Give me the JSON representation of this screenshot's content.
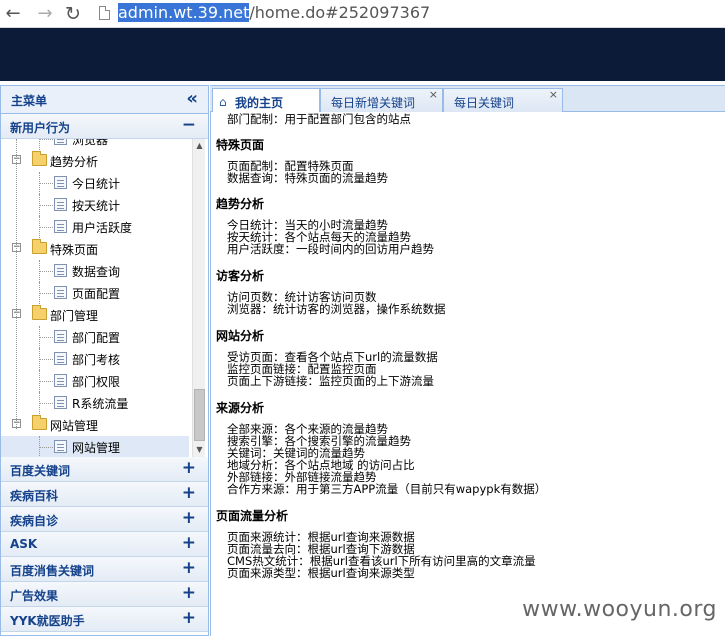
{
  "browser": {
    "url_selected": "admin.wt.39.net",
    "url_rest": "/home.do#252097367"
  },
  "sidebar": {
    "title": "主菜单",
    "section": "新用户行为",
    "section_toggle": "−",
    "tree": [
      {
        "label": "浏览器",
        "kind": "leaf"
      },
      {
        "label": "趋势分析",
        "kind": "folder",
        "toggle": "−"
      },
      {
        "label": "今日统计",
        "kind": "leaf"
      },
      {
        "label": "按天统计",
        "kind": "leaf"
      },
      {
        "label": "用户活跃度",
        "kind": "leaf"
      },
      {
        "label": "特殊页面",
        "kind": "folder",
        "toggle": "−"
      },
      {
        "label": "数据查询",
        "kind": "leaf"
      },
      {
        "label": "页面配置",
        "kind": "leaf"
      },
      {
        "label": "部门管理",
        "kind": "folder",
        "toggle": "−"
      },
      {
        "label": "部门配置",
        "kind": "leaf"
      },
      {
        "label": "部门考核",
        "kind": "leaf"
      },
      {
        "label": "部门权限",
        "kind": "leaf"
      },
      {
        "label": "R系统流量",
        "kind": "leaf"
      },
      {
        "label": "网站管理",
        "kind": "folder",
        "toggle": "−"
      },
      {
        "label": "网站管理",
        "kind": "leaf",
        "selected": true
      }
    ],
    "accordions": [
      {
        "label": "百度关键词",
        "toggle": "+"
      },
      {
        "label": "疾病百科",
        "toggle": "+"
      },
      {
        "label": "疾病自诊",
        "toggle": "+"
      },
      {
        "label": "ASK",
        "toggle": "+"
      },
      {
        "label": "百度消售关键词",
        "toggle": "+"
      },
      {
        "label": "广告效果",
        "toggle": "+"
      },
      {
        "label": "YYK就医助手",
        "toggle": "+"
      }
    ]
  },
  "tabs": [
    {
      "label": "我的主页",
      "active": true
    },
    {
      "label": "每日新增关键词",
      "close": "×"
    },
    {
      "label": "每日关键词",
      "close": "×"
    }
  ],
  "content": {
    "top_line": "部门配制：用于配置部门包含的站点",
    "sections": [
      {
        "title": "特殊页面",
        "lines": [
          "页面配制：配置特殊页面",
          "数据查询：特殊页面的流量趋势"
        ]
      },
      {
        "title": "趋势分析",
        "lines": [
          "今日统计：当天的小时流量趋势",
          "按天统计：各个站点每天的流量趋势",
          "用户活跃度：一段时间内的回访用户趋势"
        ]
      },
      {
        "title": "访客分析",
        "lines": [
          "访问页数：统计访客访问页数",
          "浏览器：统计访客的浏览器，操作系统数据"
        ]
      },
      {
        "title": "网站分析",
        "lines": [
          "受访页面：查看各个站点下url的流量数据",
          "监控页面链接：配置监控页面",
          "页面上下游链接：监控页面的上下游流量"
        ]
      },
      {
        "title": "来源分析",
        "lines": [
          "全部来源：各个来源的流量趋势",
          "搜索引擎：各个搜索引擎的流量趋势",
          "关键词：关键词的流量趋势",
          "地域分析：各个站点地域 的访问占比",
          "外部链接：外部链接流量趋势",
          "合作方来源：用于第三方APP流量（目前只有wapypk有数据）"
        ]
      },
      {
        "title": "页面流量分析",
        "lines": [
          "页面来源统计：根据url查询来源数据",
          "页面流量去向：根据url查询下游数据",
          "CMS热文统计：根据url查看该url下所有访问里高的文章流量",
          "页面来源类型：根据url查询来源类型"
        ]
      }
    ]
  },
  "watermark": "www.wooyun.org"
}
